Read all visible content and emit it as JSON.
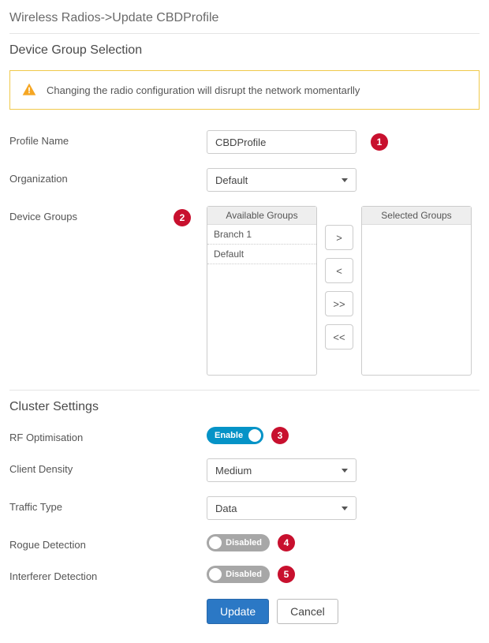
{
  "breadcrumb": "Wireless Radios->Update CBDProfile",
  "section1_title": "Device Group Selection",
  "warning": "Changing the radio configuration will disrupt the network momentarlly",
  "labels": {
    "profile_name": "Profile Name",
    "organization": "Organization",
    "device_groups": "Device Groups",
    "rf_optimisation": "RF Optimisation",
    "client_density": "Client Density",
    "traffic_type": "Traffic Type",
    "rogue_detection": "Rogue Detection",
    "interferer_detection": "Interferer Detection"
  },
  "profile_name_value": "CBDProfile",
  "organization_value": "Default",
  "available_header": "Available Groups",
  "selected_header": "Selected Groups",
  "available_groups": {
    "0": "Branch 1",
    "1": "Default"
  },
  "transfer": {
    "right": ">",
    "left": "<",
    "all_right": ">>",
    "all_left": "<<"
  },
  "section2_title": "Cluster Settings",
  "toggles": {
    "rf_enable": "Enable",
    "rogue_disabled": "Disabled",
    "interferer_disabled": "Disabled"
  },
  "client_density_value": "Medium",
  "traffic_type_value": "Data",
  "buttons": {
    "update": "Update",
    "cancel": "Cancel"
  },
  "badges": {
    "b1": "1",
    "b2": "2",
    "b3": "3",
    "b4": "4",
    "b5": "5"
  }
}
